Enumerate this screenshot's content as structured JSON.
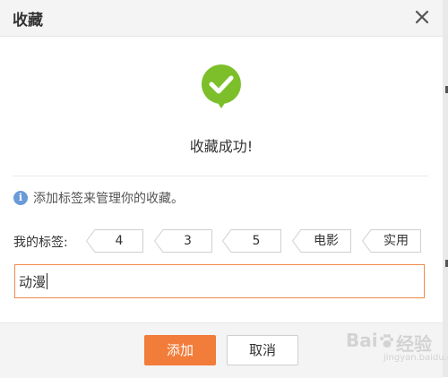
{
  "dialog": {
    "title": "收藏",
    "success_message": "收藏成功!",
    "hint": "添加标签来管理你的收藏。",
    "tags_label": "我的标签:",
    "tags": [
      "4",
      "3",
      "5",
      "电影",
      "实用"
    ],
    "input": {
      "value": "动漫"
    },
    "buttons": {
      "add": "添加",
      "cancel": "取消"
    }
  },
  "watermark": {
    "brand": "Bai",
    "brand2": "经验",
    "url": "jingyan.baidu.com"
  },
  "colors": {
    "accent": "#f27c3a",
    "success_green": "#7cbf2a",
    "input_border": "#f08a4b",
    "info_blue": "#6a9bd8"
  },
  "icons": {
    "close": "close-icon",
    "success": "check-circle-icon",
    "info": "info-icon"
  }
}
